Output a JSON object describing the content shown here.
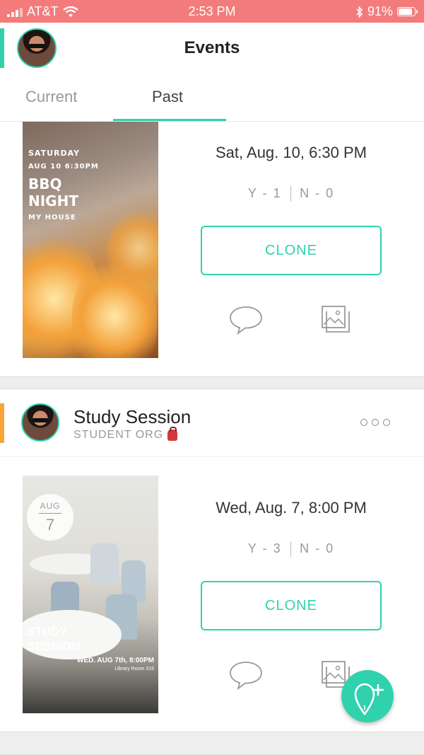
{
  "status_bar": {
    "carrier": "AT&T",
    "time": "2:53 PM",
    "battery_percent": "91%",
    "battery_level": 0.91,
    "background_color": "#f47b7b"
  },
  "header": {
    "title": "Events"
  },
  "tabs": [
    {
      "label": "Current",
      "selected": false
    },
    {
      "label": "Past",
      "selected": true
    }
  ],
  "events": [
    {
      "poster": {
        "lines": [
          "SATURDAY",
          "AUG 10 6:30PM",
          "BBQ",
          "NIGHT",
          "MY HOUSE"
        ]
      },
      "date_time": "Sat, Aug. 10, 6:30 PM",
      "rsvp_yes": "Y - 1",
      "rsvp_no": "N - 0",
      "clone_label": "CLONE",
      "comment_icon": "comment-icon",
      "gallery_icon": "gallery-icon"
    },
    {
      "title": "Study Session",
      "organization": "STUDENT ORG",
      "org_icon": "backpack-icon",
      "poster": {
        "month": "AUG",
        "day": "7",
        "title_lines": [
          "STUDY",
          "SESSION"
        ],
        "when": "WED. AUG 7th, 8:00PM",
        "where": "Library Room 315"
      },
      "date_time": "Wed, Aug. 7, 8:00 PM",
      "rsvp_yes": "Y - 3",
      "rsvp_no": "N - 0",
      "clone_label": "CLONE",
      "comment_icon": "comment-icon",
      "gallery_icon": "gallery-icon"
    }
  ],
  "fab": {
    "icon": "add-location-icon"
  },
  "colors": {
    "accent": "#2fd2ad",
    "org_accent": "#f8a43a"
  }
}
